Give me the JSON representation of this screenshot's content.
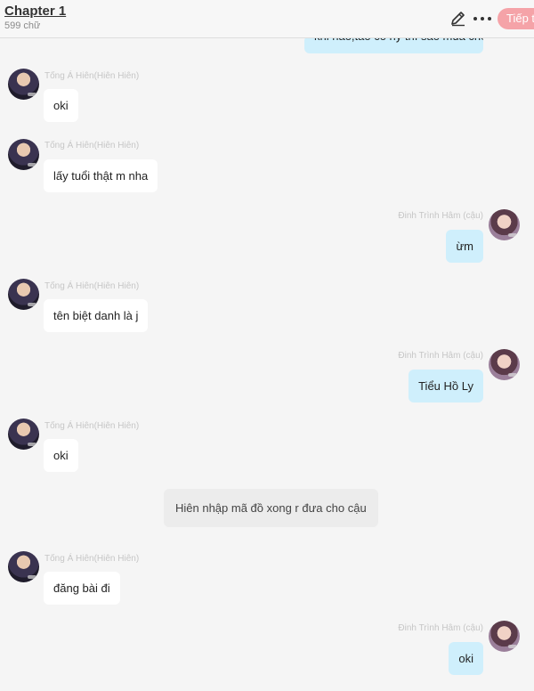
{
  "header": {
    "chapter_title": "Chapter 1",
    "word_count": "599 chữ",
    "next_label": "Tiếp t",
    "icons": [
      "pencil-icon",
      "more-icon"
    ]
  },
  "chat": {
    "left_name": "Tống Á Hiên(Hiên Hiên)",
    "right_name": "Đinh Trình Hâm (cậu)",
    "top_partial": "khi nào,tao có ny thì sao mua cho",
    "messages": [
      {
        "side": "left",
        "text": "oki"
      },
      {
        "side": "left",
        "text": "lấy tuổi thật m nha"
      },
      {
        "side": "right",
        "text": "ừm"
      },
      {
        "side": "left",
        "text": "tên biệt danh là j"
      },
      {
        "side": "right",
        "text": "Tiểu Hồ Ly"
      },
      {
        "side": "left",
        "text": "oki"
      },
      {
        "side": "system",
        "text": "Hiên nhập mã đồ xong r đưa cho cậu"
      },
      {
        "side": "left",
        "text": "đăng bài đi"
      },
      {
        "side": "right",
        "text": "oki"
      }
    ]
  },
  "colors": {
    "incoming_bubble": "#ffffff",
    "outgoing_bubble": "#cfeffc",
    "system_bubble": "#ececec",
    "next_button": "#f5a3a8"
  }
}
